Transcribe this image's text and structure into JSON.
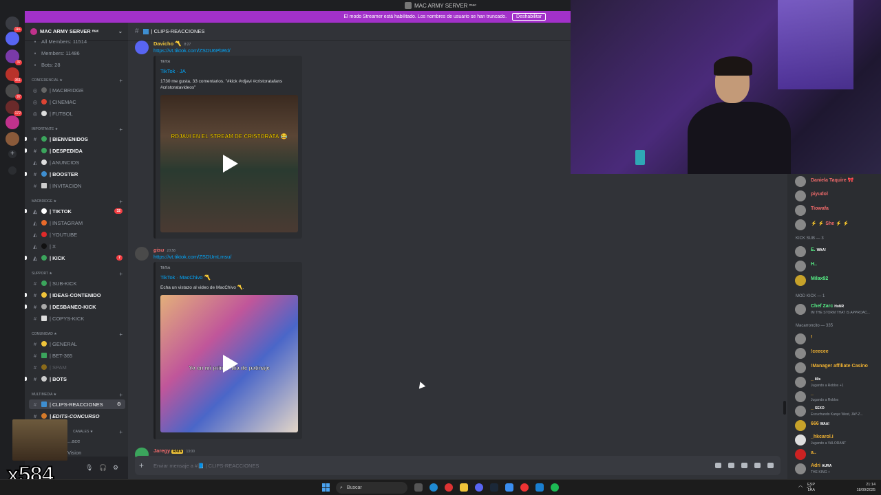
{
  "titlebar": {
    "title": "MAC ARMY SERVER ᵐᵃᶜ"
  },
  "banner": {
    "text": "El modo Streamer está habilitado. Los nombres de usuario se han truncado.",
    "button": "Deshabilitar"
  },
  "rail": {
    "badges": [
      "1k+",
      "37",
      "361",
      "97",
      "172"
    ]
  },
  "server": {
    "name": "MAC ARMY SERVER ᵐᵃᶜ",
    "stats": [
      "All Members: 11514",
      "Members: 11486",
      "Bots: 28"
    ]
  },
  "categories": {
    "conferencial": "CONFERENCIAL ★",
    "importante": "IMPORTANTE ★",
    "macbridge": "MACBRIDGE ★",
    "support": "SUPPORT ★",
    "comunidad": "COMUNIDAD ★",
    "multimedia": "MULTIMEDIA ★",
    "canales": "CANALES ★"
  },
  "channels": {
    "macbridge": "| MACBRIDGE",
    "cinemac": "| CINEMAC",
    "futbol": "| FUTBOL",
    "bienvenidos": "| BIENVENIDOS",
    "despedida": "| DESPEDIDA",
    "anuncios": "| ANUNCIOS",
    "booster": "| BOOSTER",
    "invitacion": "| INVITACION",
    "tiktok": "| TIKTOK",
    "tiktok_badge": "32",
    "instagram": "| INSTAGRAM",
    "youtube": "| YOUTUBE",
    "x": "| X",
    "kick": "| KICK",
    "kick_badge": "7",
    "subkick": "| SUB-KICK",
    "ideas": "| IDEAS-CONTENIDO",
    "desbaneo": "| DESBANEO-KICK",
    "copys": "| COPYS-KICK",
    "general": "| GENERAL",
    "bet": "| BET-365",
    "spam": "| SPAM",
    "bots": "| BOTS",
    "clips": "| CLIPS-REACCIONES",
    "edits": "| EDITS-CONCURSO",
    "space": "...ace",
    "vision": "Vision"
  },
  "overlay": {
    "counter": "x584"
  },
  "main": {
    "channel_title": "| CLIPS-REACCIONES",
    "messages": [
      {
        "author": "Davicho 〽️",
        "time": "8:27",
        "link": "https://vt.tiktok.com/ZSDU6PbRd/",
        "provider": "TikTok",
        "title": "TikTok · JA",
        "desc": "1730 me gusta, 33 comentarios. \"#kick #rdjavi #cristoratafans #cristoratavideos\"",
        "caption": "RDJAVI EN EL STREAM DE CRISTORATA 😂"
      },
      {
        "author": "gisu",
        "time": "10:56",
        "link": "https://vt.tiktok.com/ZSDUmLmsu/",
        "provider": "TikTok",
        "title": "TikTok · MacChivo 〽️",
        "desc": "Echa un vistazo al video de MacChivo 〽️.",
        "caption": "Yo en mi primer día de patinaje"
      },
      {
        "author": "Jaregy",
        "badge": "RATA",
        "time": "13:00"
      }
    ],
    "composer_placeholder": "Enviar mensaje a #📘 | CLIPS-REACCIONES"
  },
  "members": {
    "top": [
      {
        "name": "Daniela Taquire 🎀",
        "color": "#f26b6b"
      },
      {
        "name": "piyudol",
        "color": "#f26b6b"
      },
      {
        "name": "Tiowafa",
        "color": "#f26b6b"
      },
      {
        "name": "⚡ ⚡ She ⚡ ⚡",
        "color": "#f26b6b"
      }
    ],
    "kick_sub_header": "KICK SUB — 3",
    "kick_sub": [
      {
        "name": "E.",
        "tag": "WAA!",
        "color": "#57f287"
      },
      {
        "name": "H..",
        "tag": "",
        "color": "#57f287"
      },
      {
        "name": "Milax92",
        "tag": "",
        "color": "#57f287"
      }
    ],
    "mod_header": "MOD KICK — 1",
    "mod": [
      {
        "name": "Chef Zarc",
        "tag": "HoNR",
        "sub": "IM THE STORM THAT IS APPROAC...",
        "color": "#57f287"
      }
    ],
    "macarroncito_header": "Macarroncito — 335",
    "macarroncito": [
      {
        "name": "!",
        "sub": "",
        "color": "#f0b232"
      },
      {
        "name": "!ceecee",
        "sub": "",
        "color": "#f0b232"
      },
      {
        "name": "!Manager affiliate Casino",
        "sub": "",
        "color": "#f0b232"
      },
      {
        "name": "_",
        "tag": "80s",
        "sub": "Jugando a Roblox +1",
        "color": "#f0b232"
      },
      {
        "name": "_",
        "sub": "Jugando a Roblox",
        "color": "#f0b232"
      },
      {
        "name": "_",
        "tag": "SEXO",
        "sub": "Escuchando Kanye West, JAY-Z...",
        "color": "#f0b232"
      },
      {
        "name": "666",
        "tag": "WAA!",
        "sub": "",
        "color": "#f0b232"
      },
      {
        "name": "_hkcarol.i",
        "sub": "Jugando a VALORANT",
        "color": "#f0b232"
      },
      {
        "name": "a..",
        "sub": "",
        "color": "#f0b232"
      },
      {
        "name": "Adri",
        "tag": "AURA",
        "sub": "THE KING +",
        "color": "#f0b232"
      }
    ]
  },
  "taskbar": {
    "search": "Buscar",
    "lang": "ESP",
    "lang2": "LAA",
    "time": "21:14",
    "date": "18/09/2025"
  }
}
